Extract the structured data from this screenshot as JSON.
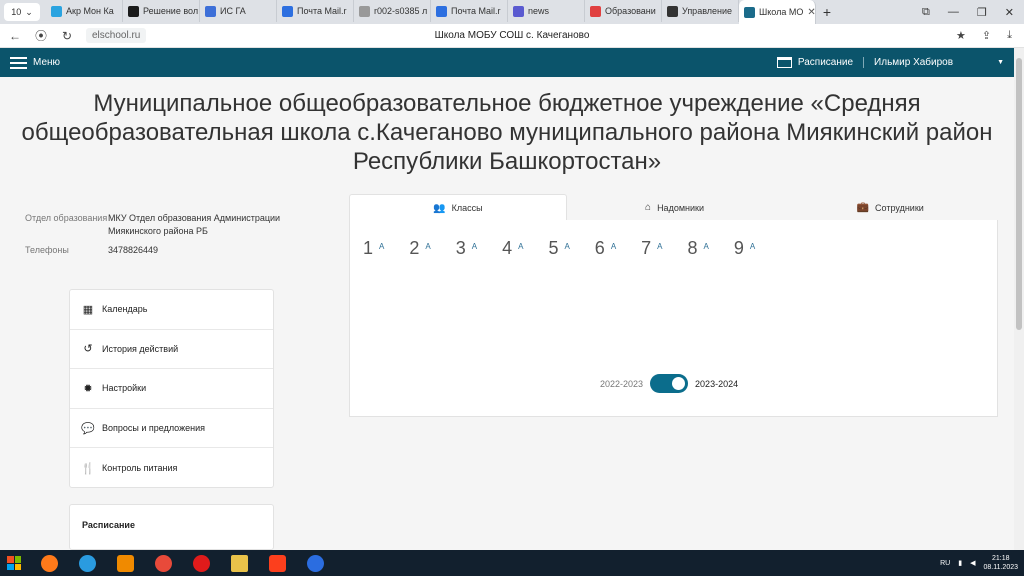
{
  "browser": {
    "tab_count": "10",
    "tabs": [
      {
        "label": "Акр Мон Ка",
        "color": "#2aa3e0"
      },
      {
        "label": "Решение вол",
        "color": "#1b1b1b"
      },
      {
        "label": "ИС ГА",
        "color": "#3d6fd8"
      },
      {
        "label": "Почта Mail.r",
        "color": "#2d6fe0"
      },
      {
        "label": "r002-s0385 л",
        "color": "#999999"
      },
      {
        "label": "Почта Mail.r",
        "color": "#2d6fe0"
      },
      {
        "label": "news",
        "color": "#5a5ad0"
      },
      {
        "label": "Образовани",
        "color": "#e04040"
      },
      {
        "label": "Управление",
        "color": "#333333"
      },
      {
        "label": "Школа МО",
        "color": "#1b6b8a"
      }
    ],
    "url": "elschool.ru",
    "page_title": "Школа МОБУ СОШ с. Качеганово"
  },
  "appbar": {
    "menu_label": "Меню",
    "schedule_label": "Расписание",
    "user_name": "Ильмир Хабиров"
  },
  "school": {
    "title": "Муниципальное общеобразовательное бюджетное учреждение «Средняя общеобразовательная школа с.Качеганово муниципального района Миякинский район Республики Башкортостан»",
    "info": [
      {
        "label": "Отдел образования",
        "value": "МКУ Отдел образования Администрации Миякинского района РБ"
      },
      {
        "label": "Телефоны",
        "value": "3478826449"
      }
    ]
  },
  "side_menu": [
    {
      "label": "Календарь",
      "icon": "calendar-icon"
    },
    {
      "label": "История действий",
      "icon": "history-icon"
    },
    {
      "label": "Настройки",
      "icon": "gear-icon"
    },
    {
      "label": "Вопросы и предложения",
      "icon": "comments-icon"
    },
    {
      "label": "Контроль питания",
      "icon": "cutlery-icon"
    }
  ],
  "schedule_card": {
    "label": "Расписание"
  },
  "panel": {
    "tabs": [
      {
        "label": "Классы",
        "icon": "users-icon"
      },
      {
        "label": "Надомники",
        "icon": "home-icon"
      },
      {
        "label": "Сотрудники",
        "icon": "briefcase-icon"
      }
    ],
    "grades": [
      {
        "num": "1",
        "letter": "А"
      },
      {
        "num": "2",
        "letter": "А"
      },
      {
        "num": "3",
        "letter": "А"
      },
      {
        "num": "4",
        "letter": "А"
      },
      {
        "num": "5",
        "letter": "А"
      },
      {
        "num": "6",
        "letter": "А"
      },
      {
        "num": "7",
        "letter": "А"
      },
      {
        "num": "8",
        "letter": "А"
      },
      {
        "num": "9",
        "letter": "А"
      }
    ],
    "year_prev": "2022-2023",
    "year_current": "2023-2024"
  },
  "taskbar": {
    "lang": "RU",
    "time": "21:18",
    "date": "08.11.2023"
  },
  "colors": {
    "appbar": "#0b546b",
    "toggle": "#0b6d8c",
    "link": "#2d6f95"
  }
}
